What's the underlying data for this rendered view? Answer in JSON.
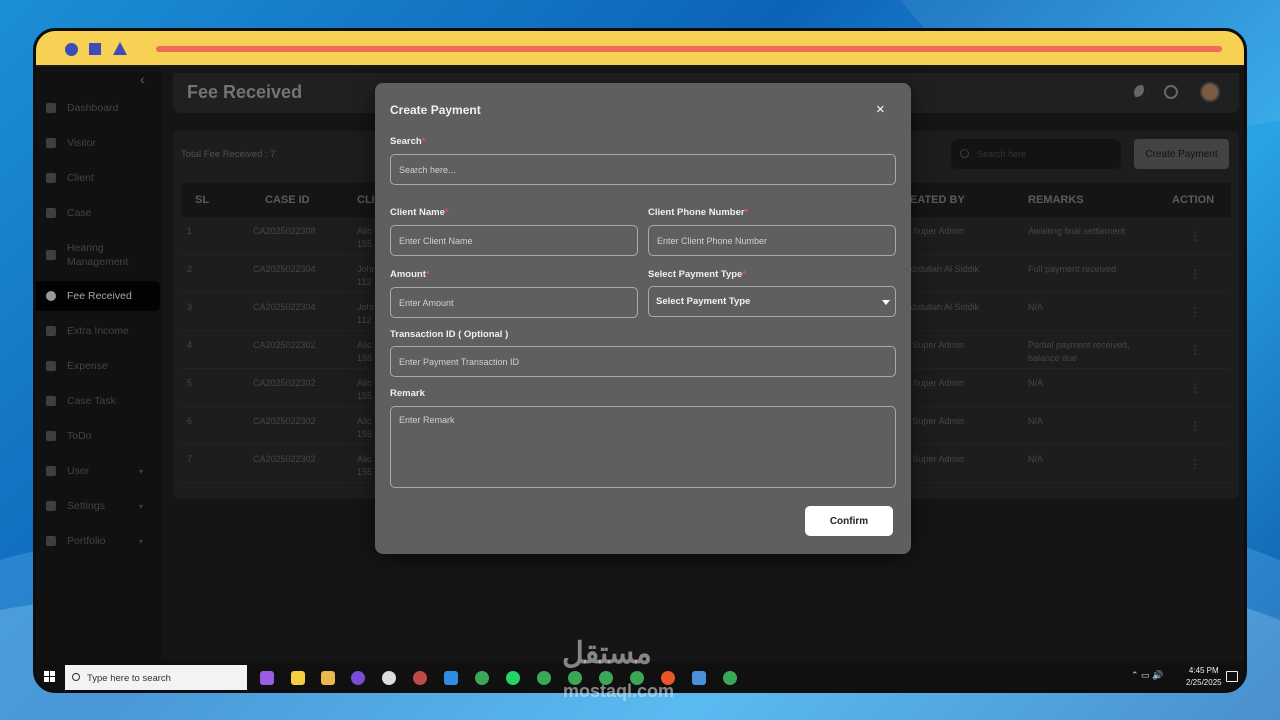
{
  "sidebar": {
    "items": [
      {
        "label": "Dashboard"
      },
      {
        "label": "Visitor"
      },
      {
        "label": "Client"
      },
      {
        "label": "Case"
      },
      {
        "label": "Hearing Management"
      },
      {
        "label": "Fee Received",
        "active": true
      },
      {
        "label": "Extra Income"
      },
      {
        "label": "Expense"
      },
      {
        "label": "Case Task"
      },
      {
        "label": "ToDo"
      },
      {
        "label": "User",
        "has_submenu": true
      },
      {
        "label": "Settings",
        "has_submenu": true
      },
      {
        "label": "Portfolio",
        "has_submenu": true
      }
    ]
  },
  "header": {
    "title": "Fee Received"
  },
  "table_card": {
    "total_label": "Total Fee Received : 7",
    "search_placeholder": "Search here",
    "create_button": "Create Payment",
    "columns": [
      "SL",
      "CASE ID",
      "CLI",
      "EATED BY",
      "REMARKS",
      "ACTION"
    ],
    "rows": [
      {
        "sl": "1",
        "case_id": "CA2025022308",
        "client": "Alic",
        "phone": "155",
        "created_by": "r Super Admin",
        "remarks": "Awaiting final settlement",
        "remarks2": ""
      },
      {
        "sl": "2",
        "case_id": "CA2025022304",
        "client": "John",
        "phone": "112",
        "created_by": "Abdullah Al Siddik",
        "remarks": "Full payment received",
        "remarks2": ""
      },
      {
        "sl": "3",
        "case_id": "CA2025022304",
        "client": "John",
        "phone": "112",
        "created_by": "Abdullah Al Siddik",
        "remarks": "N/A",
        "remarks2": ""
      },
      {
        "sl": "4",
        "case_id": "CA2025022302",
        "client": "Alic",
        "phone": "155",
        "created_by": "r Super Admin",
        "remarks": "Partial payment received,",
        "remarks2": "balance due"
      },
      {
        "sl": "5",
        "case_id": "CA2025022302",
        "client": "Alic",
        "phone": "155",
        "created_by": "r Super Admin",
        "remarks": "N/A",
        "remarks2": ""
      },
      {
        "sl": "6",
        "case_id": "CA2025022302",
        "client": "Alic",
        "phone": "155",
        "created_by": "r Super Admin",
        "remarks": "N/A",
        "remarks2": ""
      },
      {
        "sl": "7",
        "case_id": "CA2025022302",
        "client": "Alic",
        "phone": "155",
        "created_by": "r Super Admin",
        "remarks": "N/A",
        "remarks2": ""
      }
    ],
    "action_icon": "more-vertical-icon"
  },
  "modal": {
    "title": "Create Payment",
    "search_label": "Search",
    "search_placeholder": "Search here...",
    "client_name_label": "Client Name",
    "client_name_placeholder": "Enter Client Name",
    "client_phone_label": "Client Phone Number",
    "client_phone_placeholder": "Enter Client Phone Number",
    "amount_label": "Amount",
    "amount_placeholder": "Enter Amount",
    "payment_type_label": "Select Payment Type",
    "payment_type_value": "Select Payment Type",
    "transaction_label": "Transaction ID ( Optional )",
    "transaction_placeholder": "Enter Payment Transaction ID",
    "remark_label": "Remark",
    "remark_placeholder": "Enter Remark",
    "required_mark": "*",
    "close_symbol": "×",
    "confirm_button": "Confirm"
  },
  "taskbar": {
    "search_placeholder": "Type here to search",
    "time": "4:45 PM",
    "date": "2/25/2025"
  },
  "watermark": {
    "arabic": "مستقل",
    "latin": "mostaql.com"
  },
  "colors": {
    "frame_top": "#f7d154",
    "frame_line": "#ef6b57",
    "frame_shapes": "#3d4db8",
    "modal_bg": "#5f5f5f"
  }
}
